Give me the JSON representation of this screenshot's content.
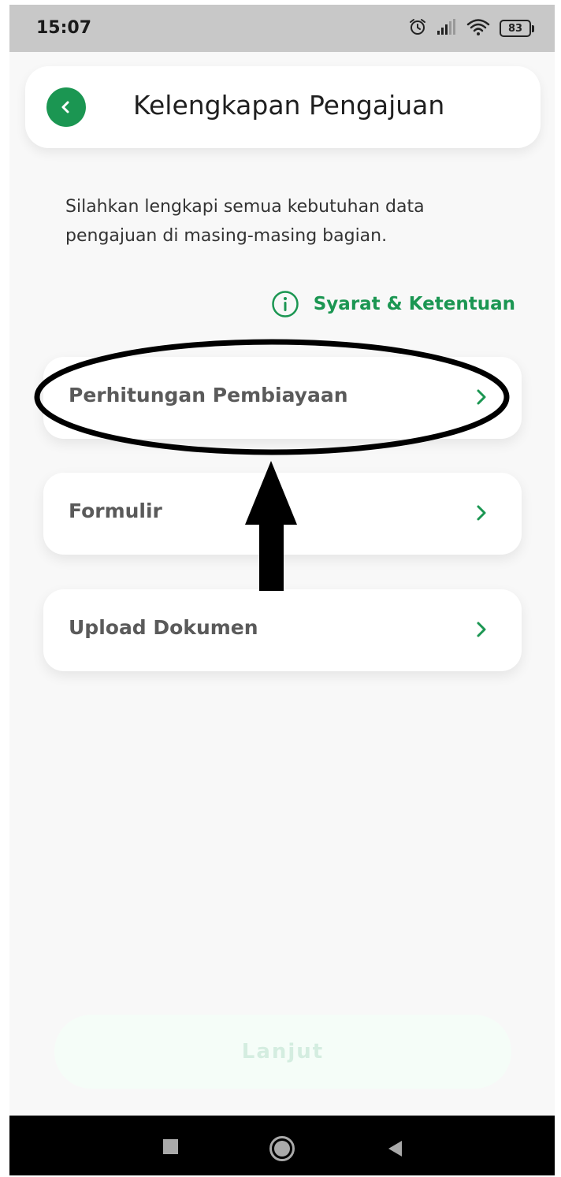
{
  "status_bar": {
    "time": "15:07",
    "icons": [
      "alarm-icon",
      "signal-icon",
      "wifi-icon",
      "battery-icon"
    ],
    "battery_level": "83"
  },
  "header": {
    "title": "Kelengkapan Pengajuan",
    "back_icon": "chevron-left-icon"
  },
  "description": "Silahkan lengkapi semua kebutuhan data pengajuan di masing-masing bagian.",
  "terms_link": {
    "icon": "info-icon",
    "label": "Syarat & Ketentuan"
  },
  "menu": [
    {
      "label": "Perhitungan Pembiayaan",
      "icon": "chevron-right-icon"
    },
    {
      "label": "Formulir",
      "icon": "chevron-right-icon"
    },
    {
      "label": "Upload Dokumen",
      "icon": "chevron-right-icon"
    }
  ],
  "primary_button": {
    "label": "Lanjut",
    "enabled": false
  },
  "nav_bar": [
    "recents-square-icon",
    "home-circle-icon",
    "back-triangle-icon"
  ],
  "colors": {
    "accent": "#1b9652",
    "status_bar": "#c8c8c8",
    "background": "#f8f8f8",
    "annotation": "#000000"
  }
}
